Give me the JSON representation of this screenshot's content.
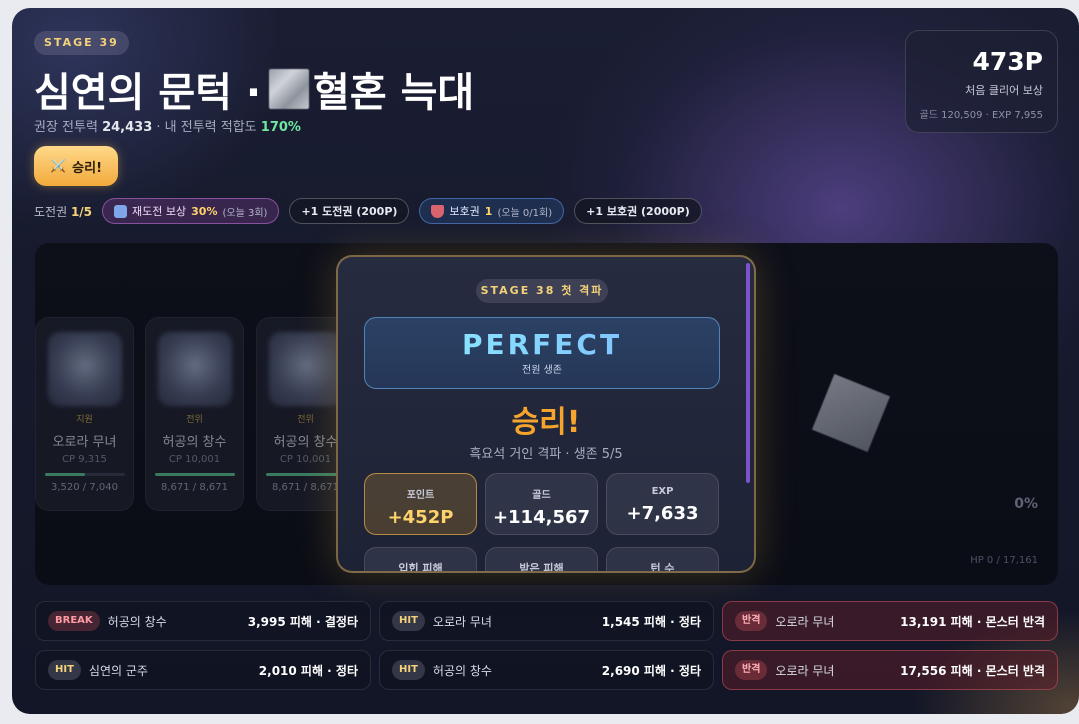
{
  "header": {
    "stage_tag": "STAGE 39",
    "title_a": "심연의 문턱 ·",
    "title_b": "혈혼 늑대",
    "rec_label": "권장 전투력",
    "rec_value": "24,433",
    "my_label": "· 내 전투력 적합도",
    "my_value": "170%"
  },
  "victory_button": {
    "icon": "⚔️",
    "label": "승리!"
  },
  "reward": {
    "points": "473P",
    "label": "처음 클리어 보상",
    "detail": "골드 120,509 · EXP 7,955"
  },
  "tickets": {
    "label": "도전권",
    "count": "1/5",
    "retry_label": "재도전 보상",
    "retry_pct": "30%",
    "retry_note": "(오늘 3회)",
    "buy_ticket": "+1 도전권 (200P)",
    "shield_label": "보호권",
    "shield_count": "1",
    "shield_note": "(오늘 0/1회)",
    "buy_shield": "+1 보호권 (2000P)"
  },
  "units": [
    {
      "role": "지원",
      "name": "오로라 무녀",
      "cp": "CP 9,315",
      "hp": "3,520 / 7,040",
      "hp_ratio": 0.5
    },
    {
      "role": "전위",
      "name": "허공의 창수",
      "cp": "CP 10,001",
      "hp": "8,671 / 8,671",
      "hp_ratio": 1
    },
    {
      "role": "전위",
      "name": "허공의 창수",
      "cp": "CP 10,001",
      "hp": "8,671 / 8,671",
      "hp_ratio": 1
    }
  ],
  "arena": {
    "monster_pct": "0%",
    "monster_hp": "HP 0 / 17,161"
  },
  "result_modal": {
    "tag": "STAGE 38 첫 격파",
    "perfect": "PERFECT",
    "perfect_sub": "전원 생존",
    "win": "승리!",
    "desc": "흑요석 거인 격파 · 생존 5/5",
    "stats": [
      {
        "label": "포인트",
        "value": "+452P"
      },
      {
        "label": "골드",
        "value": "+114,567"
      },
      {
        "label": "EXP",
        "value": "+7,633"
      }
    ],
    "stats2": [
      "입힌 피해",
      "받은 피해",
      "턴 수"
    ]
  },
  "battle_log": [
    {
      "badge": "BREAK",
      "who": "허공의 창수",
      "dmg": "3,995 피해 · 결정타",
      "type": "break"
    },
    {
      "badge": "HIT",
      "who": "오로라 무녀",
      "dmg": "1,545 피해 · 정타",
      "type": "hit"
    },
    {
      "badge": "반격",
      "who": "오로라 무녀",
      "dmg": "13,191 피해 · 몬스터 반격",
      "type": "counter"
    },
    {
      "badge": "HIT",
      "who": "심연의 군주",
      "dmg": "2,010 피해 · 정타",
      "type": "hit"
    },
    {
      "badge": "HIT",
      "who": "허공의 창수",
      "dmg": "2,690 피해 · 정타",
      "type": "hit"
    },
    {
      "badge": "반격",
      "who": "오로라 무녀",
      "dmg": "17,556 피해 · 몬스터 반격",
      "type": "counter"
    }
  ]
}
